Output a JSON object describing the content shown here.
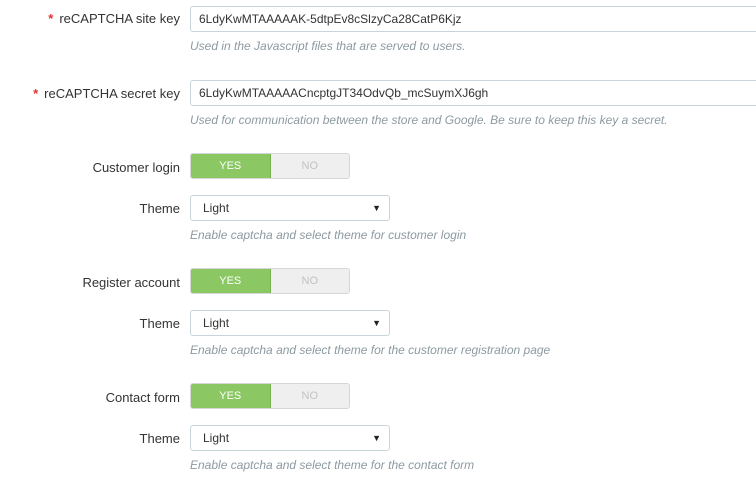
{
  "site_key": {
    "required_mark": "*",
    "label": "reCAPTCHA site key",
    "value": "6LdyKwMTAAAAAK-5dtpEv8cSlzyCa28CatP6Kjz",
    "hint": "Used in the Javascript files that are served to users."
  },
  "secret_key": {
    "required_mark": "*",
    "label": "reCAPTCHA secret key",
    "value": "6LdyKwMTAAAAACncptgJT34OdvQb_mcSuymXJ6gh",
    "hint": "Used for communication between the store and Google. Be sure to keep this key a secret."
  },
  "customer_login": {
    "label": "Customer login",
    "yes": "YES",
    "no": "NO",
    "enabled": true,
    "theme_label": "Theme",
    "theme_value": "Light",
    "hint": "Enable captcha and select theme for customer login"
  },
  "register_account": {
    "label": "Register account",
    "yes": "YES",
    "no": "NO",
    "enabled": true,
    "theme_label": "Theme",
    "theme_value": "Light",
    "hint": "Enable captcha and select theme for the customer registration page"
  },
  "contact_form": {
    "label": "Contact form",
    "yes": "YES",
    "no": "NO",
    "enabled": true,
    "theme_label": "Theme",
    "theme_value": "Light",
    "hint": "Enable captcha and select theme for the contact form"
  },
  "colors": {
    "toggle_on": "#8bc763",
    "required": "#e03131",
    "hint_text": "#8c9aa1"
  },
  "icons": {
    "select_caret": "caret-down-icon"
  }
}
